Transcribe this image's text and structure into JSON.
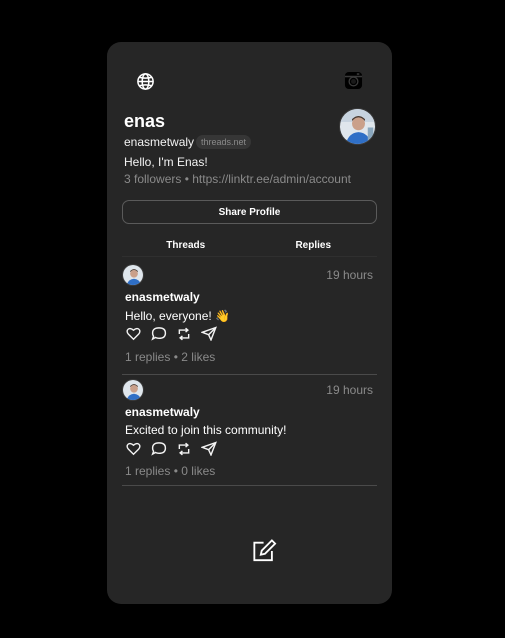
{
  "profile": {
    "name": "enas",
    "handle": "enasmetwaly",
    "domain_badge": "threads.net",
    "bio": "Hello, I'm Enas!",
    "meta": "3 followers • https://linktr.ee/admin/account",
    "share_label": "Share Profile"
  },
  "icons": {
    "top_left": "globe-icon",
    "top_right": "instagram-icon",
    "compose": "compose-icon",
    "actions": [
      "heart-icon",
      "comment-icon",
      "repost-icon",
      "send-icon"
    ]
  },
  "tabs": [
    {
      "label": "Threads",
      "active": true
    },
    {
      "label": "Replies",
      "active": false
    }
  ],
  "posts": [
    {
      "author": "enasmetwaly",
      "time": "19 hours",
      "text": "Hello, everyone! 👋",
      "stats": "1 replies • 2 likes"
    },
    {
      "author": "enasmetwaly",
      "time": "19 hours",
      "text": "Excited to join this community!",
      "stats": "1 replies • 0 likes"
    }
  ],
  "colors": {
    "background": "#000000",
    "card": "#262626",
    "text_primary": "#ffffff",
    "text_secondary": "#8a8a8a"
  }
}
